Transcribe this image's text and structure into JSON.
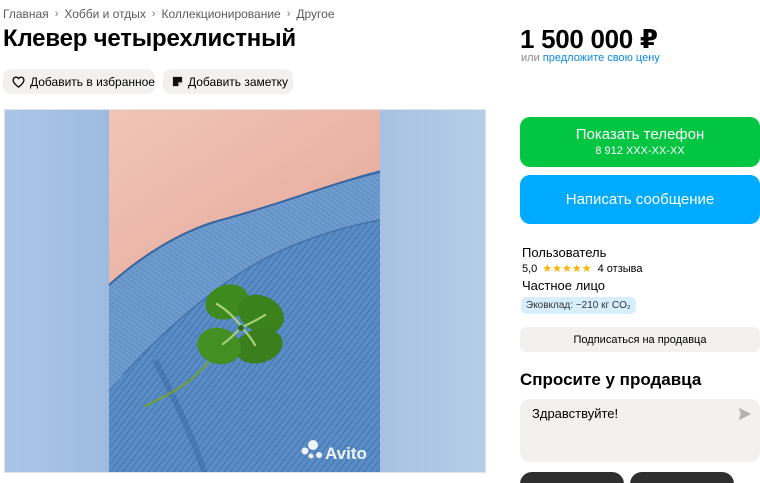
{
  "breadcrumb": {
    "items": [
      "Главная",
      "Хобби и отдых",
      "Коллекционирование",
      "Другое"
    ],
    "separator": "›"
  },
  "title": "Клевер четырехлистный",
  "actions": {
    "favorite": "Добавить в избранное",
    "note": "Добавить заметку"
  },
  "gallery": {
    "watermark": "Avito"
  },
  "price": {
    "value": "1 500 000 ₽",
    "or": "или",
    "offer_link": "предложите свою цену"
  },
  "contact": {
    "phone_label": "Показать телефон",
    "phone_masked": "8 912 XXX-XX-XX",
    "message_label": "Написать сообщение"
  },
  "seller": {
    "name": "Пользователь",
    "rating": "5,0",
    "stars": "★★★★★",
    "reviews": "4 отзыва",
    "type": "Частное лицо",
    "eco_badge": "Эковклад: −210 кг CO₂",
    "subscribe": "Подписаться на продавца"
  },
  "ask": {
    "title": "Спросите у продавца",
    "input_value": "Здравствуйте!"
  },
  "colors": {
    "green": "#02c542",
    "blue": "#00aaff",
    "link": "#0a8ae6",
    "star": "#ffb300",
    "badge_bg": "#d7effd",
    "chip_bg": "#f2f1f0"
  }
}
